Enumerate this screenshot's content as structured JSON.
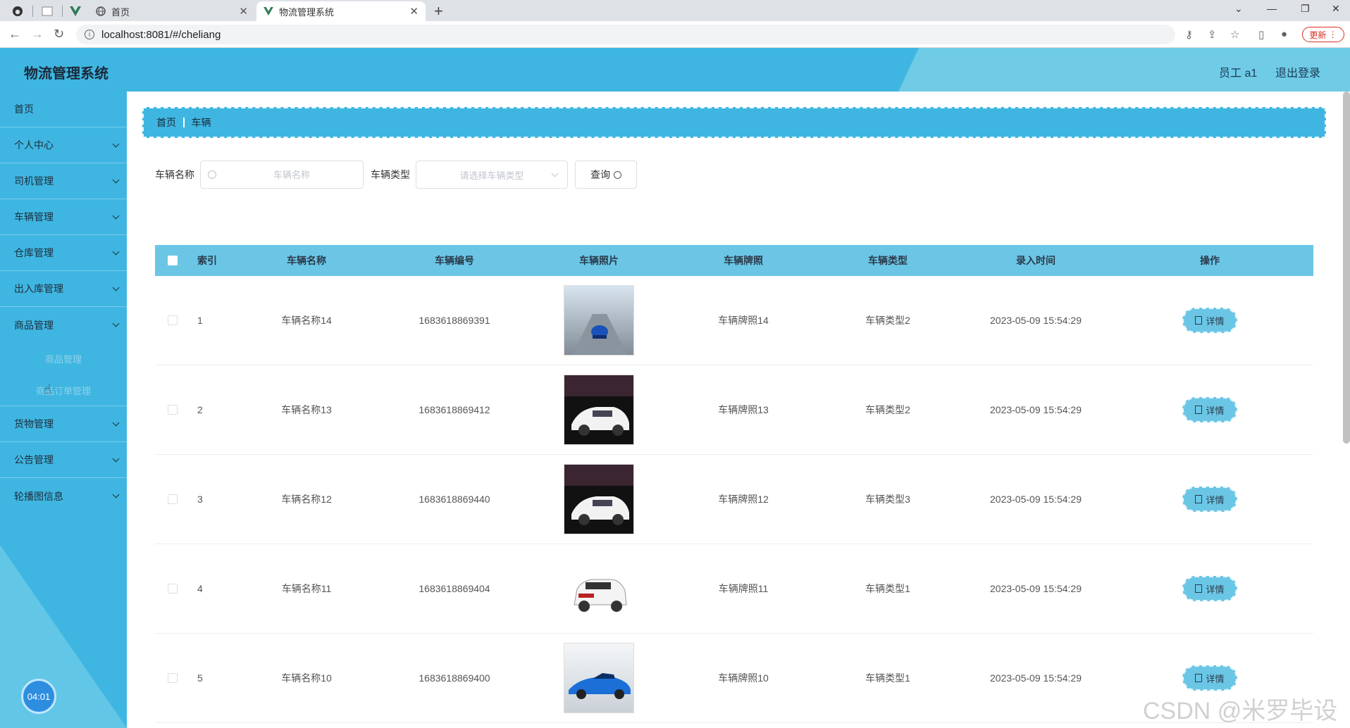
{
  "browser": {
    "tabs": [
      {
        "label": "首页"
      },
      {
        "label": "物流管理系统"
      }
    ],
    "url": "localhost:8081/#/cheliang",
    "update_label": "更新"
  },
  "header": {
    "title": "物流管理系统",
    "user": "员工 a1",
    "logout": "退出登录"
  },
  "sidebar": {
    "items": [
      {
        "label": "首页"
      },
      {
        "label": "个人中心"
      },
      {
        "label": "司机管理"
      },
      {
        "label": "车辆管理"
      },
      {
        "label": "仓库管理"
      },
      {
        "label": "出入库管理"
      },
      {
        "label": "商品管理"
      }
    ],
    "subitems": [
      {
        "label": "商品管理"
      },
      {
        "label": "商品订单管理"
      }
    ],
    "items_after": [
      {
        "label": "货物管理"
      },
      {
        "label": "公告管理"
      },
      {
        "label": "轮播图信息"
      }
    ],
    "timer": "04:01"
  },
  "breadcrumb": {
    "home": "首页",
    "current": "车辆"
  },
  "search": {
    "name_label": "车辆名称",
    "name_placeholder": "车辆名称",
    "type_label": "车辆类型",
    "type_placeholder": "请选择车辆类型",
    "query_label": "查询"
  },
  "table": {
    "headers": [
      "索引",
      "车辆名称",
      "车辆编号",
      "车辆照片",
      "车辆牌照",
      "车辆类型",
      "录入时间",
      "操作"
    ],
    "detail_label": "详情",
    "rows": [
      {
        "index": "1",
        "name": "车辆名称14",
        "number": "1683618869391",
        "plate": "车辆牌照14",
        "type": "车辆类型2",
        "time": "2023-05-09 15:54:29"
      },
      {
        "index": "2",
        "name": "车辆名称13",
        "number": "1683618869412",
        "plate": "车辆牌照13",
        "type": "车辆类型2",
        "time": "2023-05-09 15:54:29"
      },
      {
        "index": "3",
        "name": "车辆名称12",
        "number": "1683618869440",
        "plate": "车辆牌照12",
        "type": "车辆类型3",
        "time": "2023-05-09 15:54:29"
      },
      {
        "index": "4",
        "name": "车辆名称11",
        "number": "1683618869404",
        "plate": "车辆牌照11",
        "type": "车辆类型1",
        "time": "2023-05-09 15:54:29"
      },
      {
        "index": "5",
        "name": "车辆名称10",
        "number": "1683618869400",
        "plate": "车辆牌照10",
        "type": "车辆类型1",
        "time": "2023-05-09 15:54:29"
      }
    ]
  },
  "watermark": "CSDN @米罗毕设"
}
